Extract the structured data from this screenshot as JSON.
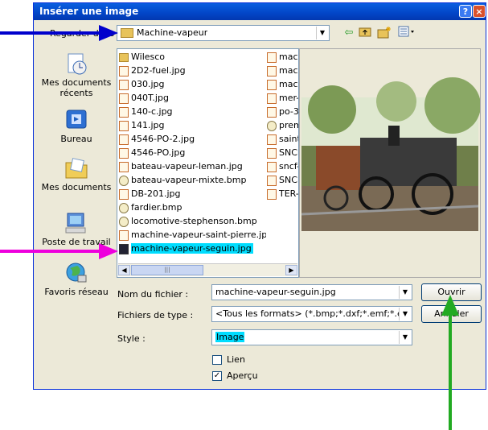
{
  "dialog": {
    "title": "Insérer une image",
    "help_btn": "?",
    "close_btn": "X"
  },
  "lookin": {
    "label": "Regarder dans :",
    "value": "Machine-vapeur"
  },
  "toolbar": {
    "back_icon": "back-arrow-icon",
    "up_icon": "up-folder-icon",
    "newfolder_icon": "new-folder-icon",
    "views_icon": "views-menu-icon"
  },
  "places": [
    {
      "label": "Mes documents récents",
      "icon": "recent-documents-icon"
    },
    {
      "label": "Bureau",
      "icon": "desktop-icon"
    },
    {
      "label": "Mes documents",
      "icon": "my-documents-icon"
    },
    {
      "label": "Poste de travail",
      "icon": "my-computer-icon"
    },
    {
      "label": "Favoris réseau",
      "icon": "network-places-icon"
    }
  ],
  "files_col1": [
    {
      "name": "Wilesco",
      "type": "folder"
    },
    {
      "name": "2D2-fuel.jpg",
      "type": "jpg"
    },
    {
      "name": "030.jpg",
      "type": "jpg"
    },
    {
      "name": "040T.jpg",
      "type": "jpg"
    },
    {
      "name": "140-c.jpg",
      "type": "jpg"
    },
    {
      "name": "141.jpg",
      "type": "jpg"
    },
    {
      "name": "4546-PO-2.jpg",
      "type": "jpg"
    },
    {
      "name": "4546-PO.jpg",
      "type": "jpg"
    },
    {
      "name": "bateau-vapeur-leman.jpg",
      "type": "jpg"
    },
    {
      "name": "bateau-vapeur-mixte.bmp",
      "type": "bmp"
    },
    {
      "name": "DB-201.jpg",
      "type": "jpg"
    },
    {
      "name": "fardier.bmp",
      "type": "bmp"
    },
    {
      "name": "locomotive-stephenson.bmp",
      "type": "bmp"
    },
    {
      "name": "machine-vapeur-saint-pierre.jpg",
      "type": "jpg"
    },
    {
      "name": "machine-vapeur-seguin.jpg",
      "type": "sel"
    }
  ],
  "files_col2": [
    {
      "name": "mach",
      "type": "jpg"
    },
    {
      "name": "mach",
      "type": "jpg"
    },
    {
      "name": "mach",
      "type": "jpg"
    },
    {
      "name": "mer-",
      "type": "jpg"
    },
    {
      "name": "po-3",
      "type": "jpg"
    },
    {
      "name": "prem",
      "type": "bmp"
    },
    {
      "name": "saint",
      "type": "jpg"
    },
    {
      "name": "SNCF",
      "type": "jpg"
    },
    {
      "name": "sncf-",
      "type": "jpg"
    },
    {
      "name": "SNCF",
      "type": "jpg"
    },
    {
      "name": "TER-",
      "type": "jpg"
    }
  ],
  "filename": {
    "label": "Nom du fichier :",
    "value": "machine-vapeur-seguin.jpg"
  },
  "filetype": {
    "label": "Fichiers de type :",
    "value": "<Tous les formats> (*.bmp;*.dxf;*.emf;*.eps;*.gif;*"
  },
  "style": {
    "label": "Style :",
    "value": "Image"
  },
  "buttons": {
    "open": "Ouvrir",
    "cancel": "Annuler"
  },
  "options": {
    "link": {
      "label": "Lien",
      "checked": false
    },
    "preview": {
      "label": "Aperçu",
      "checked": true
    }
  },
  "annotations": {
    "blue_arrow_color": "#0000cc",
    "magenta_arrow_color": "#ee00dd",
    "green_arrow_color": "#22aa22"
  }
}
